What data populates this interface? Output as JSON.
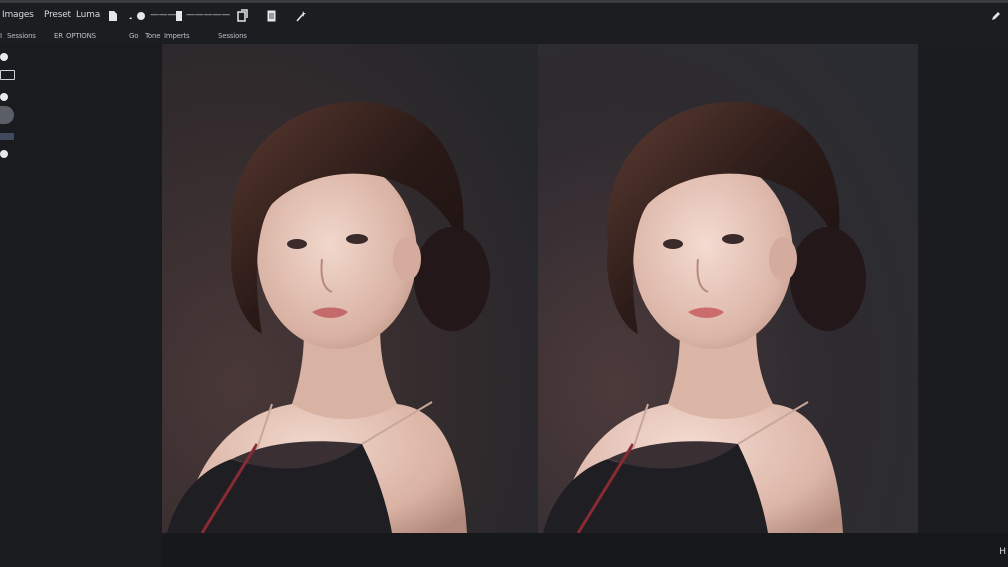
{
  "toolbar": {
    "labels": [
      "Images",
      "Preset",
      "Luma"
    ],
    "select_value": "———",
    "select_value2": "—————",
    "right_icon": "pen-icon"
  },
  "menu": {
    "items": [
      "I",
      "Sessions",
      "ER",
      "OPTIONS",
      "Go",
      "Tone",
      "Imperts",
      "Sessions"
    ]
  },
  "statusbar": {
    "text": "H"
  },
  "icons": [
    "file-icon",
    "brush-icon",
    "square-icon",
    "layers-icon",
    "page-icon",
    "wand-icon",
    "pen-icon"
  ],
  "colors": {
    "background": "#15171b",
    "panel": "#191b1f",
    "canvas": "#2a2c31",
    "accent": "#3f4a5e"
  },
  "canvas": {
    "panes": [
      "before",
      "after"
    ]
  }
}
